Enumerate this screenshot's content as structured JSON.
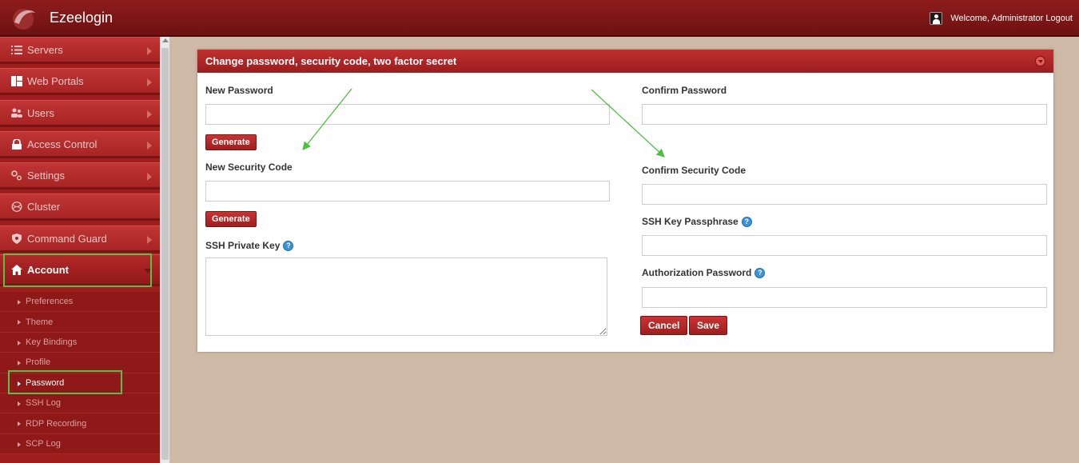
{
  "header": {
    "brand": "Ezeelogin",
    "welcome": "Welcome, Administrator Logout"
  },
  "sidebar": {
    "items": [
      {
        "label": "Servers",
        "icon": "list-icon"
      },
      {
        "label": "Web Portals",
        "icon": "grid-icon"
      },
      {
        "label": "Users",
        "icon": "users-icon"
      },
      {
        "label": "Access Control",
        "icon": "lock-icon"
      },
      {
        "label": "Settings",
        "icon": "gears-icon"
      },
      {
        "label": "Cluster",
        "icon": "cluster-icon"
      },
      {
        "label": "Command Guard",
        "icon": "shield-icon"
      },
      {
        "label": "Account",
        "icon": "home-icon"
      }
    ],
    "account_sub": [
      "Preferences",
      "Theme",
      "Key Bindings",
      "Profile",
      "Password",
      "SSH Log",
      "RDP Recording",
      "SCP Log"
    ],
    "active_sub": "Password"
  },
  "panel": {
    "title": "Change password, security code, two factor secret",
    "new_password": {
      "label": "New Password",
      "value": ""
    },
    "confirm_password": {
      "label": "Confirm Password",
      "value": ""
    },
    "generate_label": "Generate",
    "new_security_code": {
      "label": "New Security Code",
      "value": ""
    },
    "confirm_security_code": {
      "label": "Confirm Security Code",
      "value": ""
    },
    "ssh_key_passphrase": {
      "label": "SSH Key Passphrase",
      "value": ""
    },
    "ssh_private_key": {
      "label": "SSH Private Key",
      "value": ""
    },
    "authorization_password": {
      "label": "Authorization Password",
      "value": ""
    },
    "cancel_label": "Cancel",
    "save_label": "Save"
  },
  "colors": {
    "accent": "#a11d1d",
    "highlight": "#57c04a",
    "background": "#cdb9a6"
  }
}
